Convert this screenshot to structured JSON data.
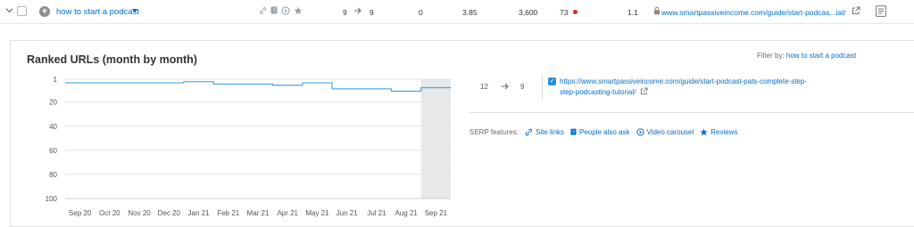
{
  "row": {
    "keyword": "how to start a podcast",
    "position_from": "9",
    "position_to": "9",
    "diff": "0",
    "cpc": "3.85",
    "volume": "3,600",
    "kd": "73",
    "com": "1.1",
    "url": "www.smartpassiveincome.com/guide/start-podcas...ial/",
    "icons": [
      "link-icon",
      "people-also-ask-icon",
      "video-icon",
      "star-icon"
    ],
    "kd_color": "#e02424"
  },
  "panel": {
    "title": "Ranked URLs (month by month)",
    "filter_label": "Filter by:",
    "filter_value": "how to start a podcast"
  },
  "chart_data": {
    "type": "line",
    "x": [
      "Sep 20",
      "Oct 20",
      "Nov 20",
      "Dec 20",
      "Jan 21",
      "Feb 21",
      "Mar 21",
      "Apr 21",
      "May 21",
      "Jun 21",
      "Jul 21",
      "Aug 21",
      "Sep 21"
    ],
    "series": [
      {
        "values": [
          4,
          4,
          4,
          4,
          3,
          5,
          5,
          6,
          4,
          9,
          9,
          11,
          8
        ]
      }
    ],
    "y_ticks": [
      "1",
      "20",
      "40",
      "60",
      "80",
      "100"
    ],
    "ylim": [
      1,
      100
    ],
    "y_inverted": true,
    "highlighted_category": "Sep 21",
    "line_color": "#4aa3df",
    "grid": true
  },
  "ranked": {
    "from": "12",
    "to": "9",
    "url": "https://www.smartpassiveincome.com/guide/start-podcast-pats-complete-step-step-podcasting-tutorial/"
  },
  "serp": {
    "label": "SERP features:",
    "items": [
      {
        "name": "Site links",
        "icon": "link-icon"
      },
      {
        "name": "People also ask",
        "icon": "people-also-ask-icon"
      },
      {
        "name": "Video carousel",
        "icon": "video-icon"
      },
      {
        "name": "Reviews",
        "icon": "star-icon"
      }
    ]
  }
}
